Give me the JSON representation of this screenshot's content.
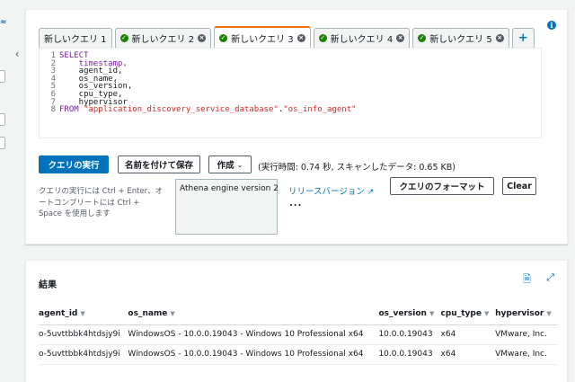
{
  "tabs": [
    {
      "label": "新しいクエリ 1",
      "active": false,
      "status": false,
      "closable": false
    },
    {
      "label": "新しいクエリ 2",
      "active": false,
      "status": true,
      "closable": true
    },
    {
      "label": "新しいクエリ 3",
      "active": true,
      "status": true,
      "closable": true
    },
    {
      "label": "新しいクエリ 4",
      "active": false,
      "status": true,
      "closable": true
    },
    {
      "label": "新しいクエリ 5",
      "active": false,
      "status": true,
      "closable": true
    }
  ],
  "add_tab_label": "+",
  "editor": {
    "lines": [
      {
        "num": "1",
        "parts": [
          {
            "t": "SELECT",
            "c": "kw"
          }
        ]
      },
      {
        "num": "2",
        "parts": [
          {
            "t": "    timestamp,",
            "c": "kw"
          }
        ]
      },
      {
        "num": "3",
        "parts": [
          {
            "t": "    agent_id,",
            "c": "id"
          }
        ]
      },
      {
        "num": "4",
        "parts": [
          {
            "t": "    os_name,",
            "c": "id"
          }
        ]
      },
      {
        "num": "5",
        "parts": [
          {
            "t": "    os_version,",
            "c": "id"
          }
        ]
      },
      {
        "num": "6",
        "parts": [
          {
            "t": "    cpu_type,",
            "c": "id"
          }
        ]
      },
      {
        "num": "7",
        "parts": [
          {
            "t": "    hypervisor",
            "c": "id"
          }
        ]
      },
      {
        "num": "8",
        "parts": [
          {
            "t": "FROM ",
            "c": "kw"
          },
          {
            "t": "\"application_discovery_service_database\"",
            "c": "str"
          },
          {
            "t": ".",
            "c": "id"
          },
          {
            "t": "\"os_info_agent\"",
            "c": "str"
          }
        ]
      }
    ]
  },
  "toolbar": {
    "run_label": "クエリの実行",
    "save_label": "名前を付けて保存",
    "create_label": "作成",
    "create_caret": "⌄",
    "exec_info": "(実行時間: 0.74 秒, スキャンしたデータ: 0.65 KB)"
  },
  "hint_text": "クエリの実行には Ctrl + Enter、オートコンプリートには Ctrl + Space を使用します",
  "engine": {
    "label": "Athena engine version 2",
    "release_link": "リリースバージョン",
    "more": "..."
  },
  "format_label": "クエリのフォーマット",
  "clear_label": "Clear",
  "results": {
    "title": "結果",
    "columns": [
      "agent_id",
      "os_name",
      "os_version",
      "cpu_type",
      "hypervisor"
    ],
    "rows": [
      [
        "o-5uvttbbk4htdsjy9i",
        "WindowsOS - 10.0.0.19043 - Windows 10 Professional x64",
        "10.0.0.19043",
        "x64",
        "VMware, Inc."
      ],
      [
        "o-5uvttbbk4htdsjy9i",
        "WindowsOS - 10.0.0.19043 - Windows 10 Professional x64",
        "10.0.0.19043",
        "x64",
        "VMware, Inc."
      ]
    ]
  },
  "colors": {
    "primary": "#0073bb",
    "active_tab_accent": "#ec7211",
    "success": "#1d8102"
  }
}
